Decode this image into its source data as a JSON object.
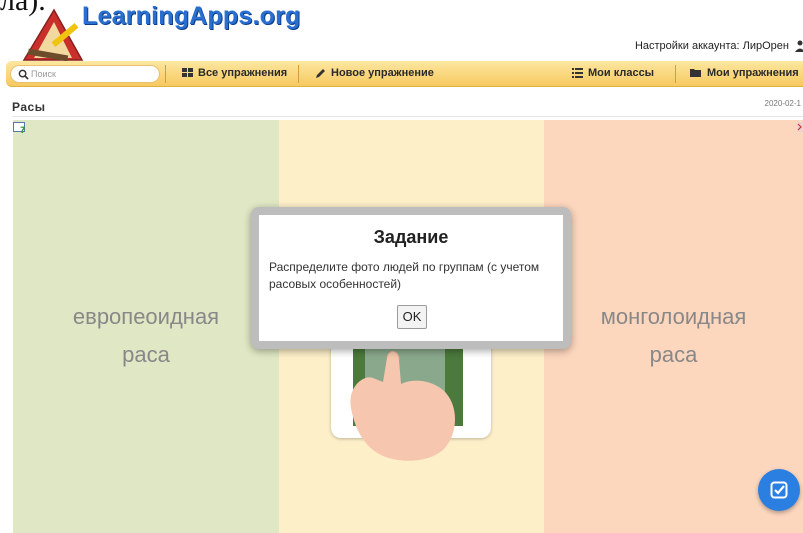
{
  "top_cut_text": "ла).",
  "logo": {
    "text": "LearningApps.org"
  },
  "account": {
    "label": "Настройки аккаунта: ЛирОрен"
  },
  "navbar": {
    "search_placeholder": "Поиск",
    "all_exercises": "Все упражнения",
    "new_exercise": "Новое упражнение",
    "my_classes": "Мои классы",
    "my_exercises": "Мои упражнения"
  },
  "page": {
    "title": "Расы",
    "date": "2020-02-1"
  },
  "game": {
    "left_zone_label": "европеоидная\nраса",
    "right_zone_label": "монголоидная\nраса"
  },
  "modal": {
    "title": "Задание",
    "text": "Распределите фото людей по группам (с учетом расовых особенностей)",
    "ok_label": "OK"
  },
  "colors": {
    "left_zone": "#dfe7c4",
    "middle_zone": "#fdefc8",
    "right_zone": "#fcd6bd",
    "navbar": "#f7c960",
    "check_button": "#2b7fe0",
    "logo": "#2a6fcf"
  },
  "icons": {
    "search": "search-icon",
    "grid": "grid-icon",
    "pencil": "pencil-icon",
    "list": "list-icon",
    "folder": "folder-icon",
    "help": "help-icon",
    "check": "check-icon",
    "user": "user-icon",
    "hand": "hand-pointer-icon"
  }
}
